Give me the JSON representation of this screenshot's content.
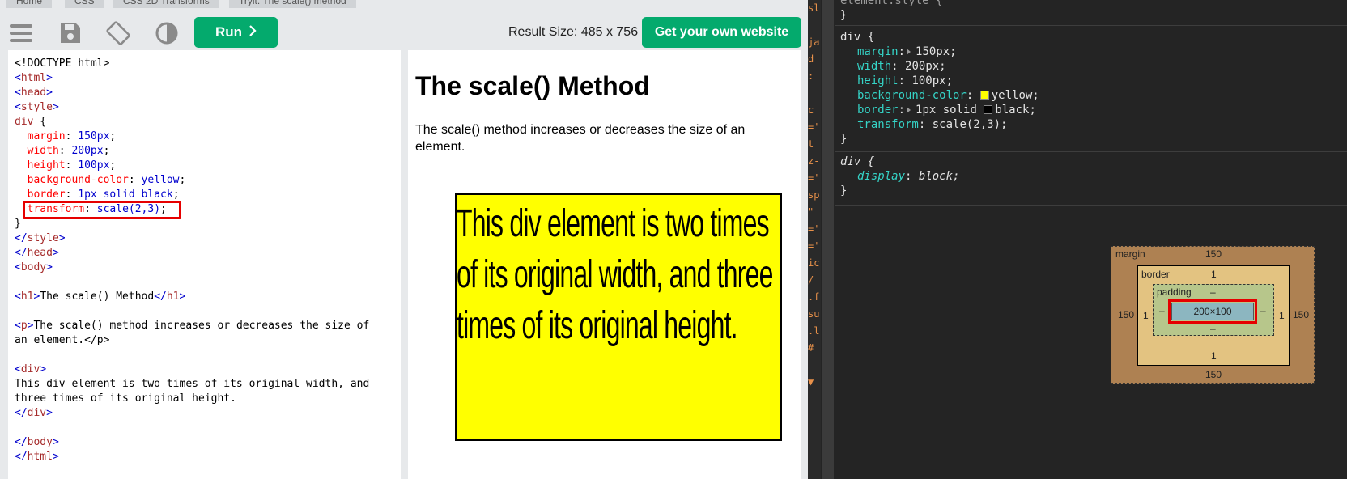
{
  "breadcrumb": [
    "Home",
    "CSS",
    "CSS 2D Transforms",
    "Tryit: The scale() method"
  ],
  "toolbar": {
    "icons": [
      "menu-icon",
      "save-icon",
      "rotate-icon",
      "contrast-icon"
    ],
    "run_label": "Run",
    "run_icon": "chevron-right-icon",
    "result_size": "Result Size: 485 x 756",
    "own_website_label": "Get your own website"
  },
  "code": {
    "lines": [
      "<!DOCTYPE html>",
      "<html>",
      "<head>",
      "<style>",
      "div {",
      "  margin: 150px;",
      "  width: 200px;",
      "  height: 100px;",
      "  background-color: yellow;",
      "  border: 1px solid black;",
      "  transform: scale(2,3);",
      "}",
      "</style>",
      "</head>",
      "<body>",
      "",
      "<h1>The scale() Method</h1>",
      "",
      "<p>The scale() method increases or decreases the size of",
      "an element.</p>",
      "",
      "<div>",
      "This div element is two times of its original width, and",
      "three times of its original height.",
      "</div>",
      "",
      "</body>",
      "</html>"
    ]
  },
  "result": {
    "heading": "The scale() Method",
    "paragraph": "The scale() method increases or decreases the size of an element.",
    "div_text": "This div element is two times of its original width, and three times of its original height."
  },
  "devtools": {
    "left_strip": [
      "sl",
      "",
      "ja",
      "d",
      ":",
      "",
      "c",
      "='",
      "t",
      "z-",
      "='",
      "sp",
      "\"",
      "='",
      "='",
      "ic",
      "/",
      ".f",
      "su",
      ".l",
      "#",
      "",
      "▼"
    ],
    "element_style_selector": "element.style {",
    "rules": [
      {
        "selector": "div {",
        "props": [
          {
            "name": "margin",
            "value": "150px;",
            "expand": true
          },
          {
            "name": "width",
            "value": "200px;"
          },
          {
            "name": "height",
            "value": "100px;"
          },
          {
            "name": "background-color",
            "value": "yellow;",
            "swatch": "#ffff00"
          },
          {
            "name": "border",
            "value": "1px solid ",
            "expand": true,
            "swatch": "#000000",
            "value2": "black;"
          },
          {
            "name": "transform",
            "value": "scale(2,3);"
          }
        ]
      },
      {
        "selector": "div {",
        "props": [
          {
            "name": "display",
            "value": "block;"
          }
        ]
      }
    ],
    "box_model": {
      "margin_label": "margin",
      "margin_top": "150",
      "margin_bottom": "150",
      "margin_left": "150",
      "margin_right": "150",
      "border_label": "border",
      "border_top": "1",
      "border_bottom": "1",
      "border_left": "1",
      "border_right": "1",
      "padding_label": "padding",
      "padding_top": "–",
      "padding_bottom": "–",
      "padding_left": "–",
      "padding_right": "–",
      "content": "200×100"
    }
  }
}
